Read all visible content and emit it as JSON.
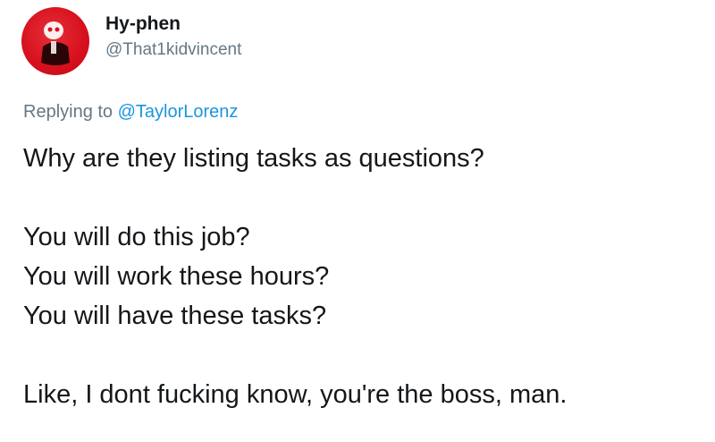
{
  "tweet": {
    "author": {
      "display_name": "Hy-phen",
      "handle": "@That1kidvincent"
    },
    "reply": {
      "prefix": "Replying to",
      "mention": "@TaylorLorenz"
    },
    "body": [
      "Why are they listing tasks as questions?",
      "You will do this job?",
      "You will work these hours?",
      "You will have these tasks?",
      "Like, I dont fucking know, you're the boss, man."
    ]
  },
  "colors": {
    "text": "#14171a",
    "secondary": "#657786",
    "link": "#1b95e0",
    "avatar": "#d6101c"
  }
}
